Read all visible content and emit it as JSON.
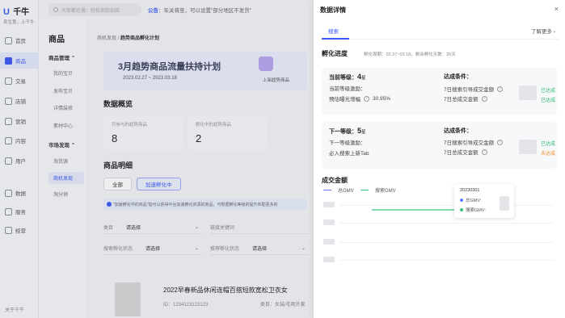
{
  "nav": {
    "logo_mark": "U",
    "logo_text": "千牛",
    "slogan": "卖生意，上千牛",
    "items": [
      {
        "label": "首页",
        "icon": "home-icon"
      },
      {
        "label": "商品",
        "icon": "product-icon",
        "active": true
      },
      {
        "label": "交易",
        "icon": "trade-icon"
      },
      {
        "label": "店铺",
        "icon": "store-icon"
      },
      {
        "label": "营销",
        "icon": "marketing-icon"
      },
      {
        "label": "内容",
        "icon": "content-icon"
      },
      {
        "label": "用户",
        "icon": "user-icon"
      },
      {
        "label": "数据",
        "icon": "data-icon"
      },
      {
        "label": "服务",
        "icon": "service-icon"
      },
      {
        "label": "经营",
        "icon": "business-icon"
      }
    ],
    "about": "关于千牛"
  },
  "topbar": {
    "search_placeholder": "大家都在搜：轻松测款招商",
    "notice_label": "公告",
    "notice_text": "：年关将至，可以设置\"部分地区不发货\""
  },
  "submenu": {
    "title": "商品",
    "groups": [
      {
        "label": "商品管理",
        "items": [
          "我的宝贝",
          "发布宝贝",
          "详情装修",
          "素材中心"
        ]
      },
      {
        "label": "市场发现",
        "items": [
          "淘货源",
          "商机发现",
          "淘分销"
        ]
      }
    ],
    "active_item": "商机发现"
  },
  "main": {
    "breadcrumb_parent": "商机发现",
    "breadcrumb_sep": "/",
    "breadcrumb_current": "趋势商品孵化计划",
    "banner_title": "3月趋势商品流量扶持计划",
    "banner_date": "2023.02.27 ~ 2023.03.18",
    "banner_link": "上架趋势商品",
    "overview_title": "数据概览",
    "stats": [
      {
        "label": "可参与的趋势商品",
        "value": "8"
      },
      {
        "label": "孵化中的趋势商品",
        "value": "2"
      }
    ],
    "detail_title": "商品明细",
    "tabs": [
      "全部",
      "加速孵化中"
    ],
    "info_text": "\"加速孵化中的商品\"指可以获得平台加速孵化资源的商品，可根据孵化等级的提升匹配更多的",
    "filters": [
      {
        "label": "类目",
        "value": "请选择"
      },
      {
        "label": "链接关键词",
        "value": ""
      },
      {
        "label": "搜索孵化状态",
        "value": "请选择"
      },
      {
        "label": "推荐孵化状态",
        "value": "请选择"
      }
    ],
    "product": {
      "title": "2022早春新品休闲连帽百搭短款宽松卫衣女",
      "id": "ID：1234123123123",
      "category": "类目：女装/毛呢外套"
    }
  },
  "drawer": {
    "title": "数据详情",
    "close": "×",
    "tab": "搜索",
    "learn_more": "了解更多 ›",
    "progress_title": "孵化进度",
    "period": "孵化周期：02.27~03.18，剩余孵化天数：20天",
    "current": {
      "level_label": "当前等级：",
      "level_num": "4",
      "level_unit": "星",
      "line1": "当前等级激励：",
      "line2_label": "预估曝光增幅",
      "line2_value": "30.95%",
      "cond_title": "达成条件：",
      "conds": [
        {
          "label": "7日搜索引导成交金额",
          "status": "已达成"
        },
        {
          "label": "7日总成交金额",
          "status": "已达成"
        }
      ]
    },
    "next": {
      "level_label": "下一等级：",
      "level_num": "5",
      "level_unit": "星",
      "line1": "下一等级激励：",
      "line2_label": "必入搜索上新Tab",
      "cond_title": "达成条件：",
      "conds": [
        {
          "label": "7日搜索引导成交金额",
          "status": "已达成"
        },
        {
          "label": "7日总成交金额",
          "status": "未达成"
        }
      ]
    },
    "gmv_title": "成交金额",
    "legend": [
      {
        "label": "总GMV",
        "color": "#5b7cf7"
      },
      {
        "label": "搜索GMV",
        "color": "#3dbd7d"
      }
    ],
    "tooltip": {
      "date": "20230301",
      "rows": [
        {
          "label": "总GMV:",
          "color": "#5b7cf7"
        },
        {
          "label": "搜索GMV:",
          "color": "#3dbd7d"
        }
      ]
    }
  },
  "colors": {
    "accent": "#3d5bf5",
    "success": "#2eb872",
    "warning": "#f08c2b"
  }
}
